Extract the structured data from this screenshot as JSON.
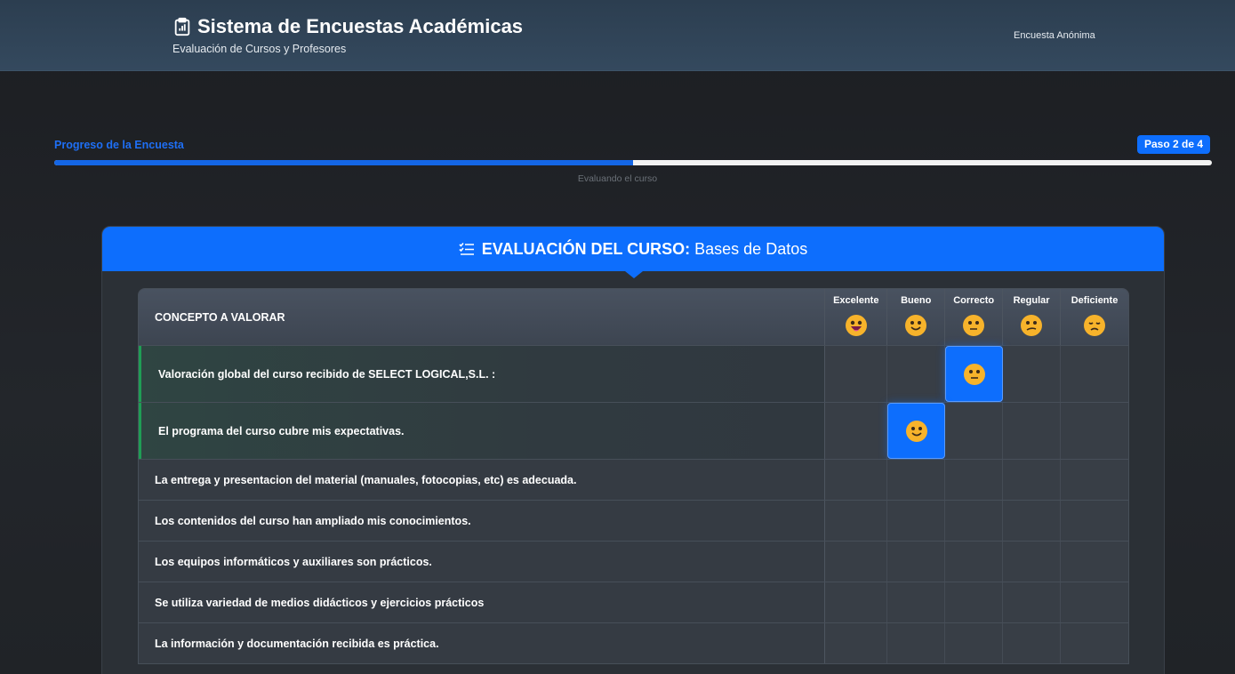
{
  "header": {
    "title": "Sistema de Encuestas Académicas",
    "subtitle": "Evaluación de Cursos y Profesores",
    "anon_label": "Encuesta Anónima",
    "icon": "clipboard-data-icon"
  },
  "progress": {
    "title": "Progreso de la Encuesta",
    "step_label": "Paso 2 de 4",
    "percent": 50,
    "status_text": "Evaluando el curso",
    "color": "#0d6efd"
  },
  "section": {
    "title_bold": "EVALUACIÓN DEL CURSO:",
    "course_name": "Bases de Datos",
    "icon": "list-check-icon",
    "accent": "#0d6efd"
  },
  "table": {
    "concept_header": "CONCEPTO A VALORAR",
    "options": [
      {
        "label": "Excelente",
        "icon": "grinning-face-icon"
      },
      {
        "label": "Bueno",
        "icon": "slightly-smiling-face-icon"
      },
      {
        "label": "Correcto",
        "icon": "neutral-face-icon"
      },
      {
        "label": "Regular",
        "icon": "confused-face-icon"
      },
      {
        "label": "Deficiente",
        "icon": "sad-face-icon"
      }
    ],
    "rows": [
      {
        "text": "Valoración global del curso recibido de SELECT LOGICAL,S.L. :",
        "selected": "Correcto"
      },
      {
        "text": "El programa del curso cubre mis expectativas.",
        "selected": "Bueno"
      },
      {
        "text": "La entrega y presentacion del material (manuales, fotocopias, etc) es adecuada.",
        "selected": null
      },
      {
        "text": "Los contenidos del curso han ampliado mis conocimientos.",
        "selected": null
      },
      {
        "text": "Los equipos informáticos y auxiliares son prácticos.",
        "selected": null
      },
      {
        "text": "Se utiliza variedad de medios didácticos y ejercicios prácticos",
        "selected": null
      },
      {
        "text": "La información y documentación recibida es práctica.",
        "selected": null
      }
    ]
  }
}
